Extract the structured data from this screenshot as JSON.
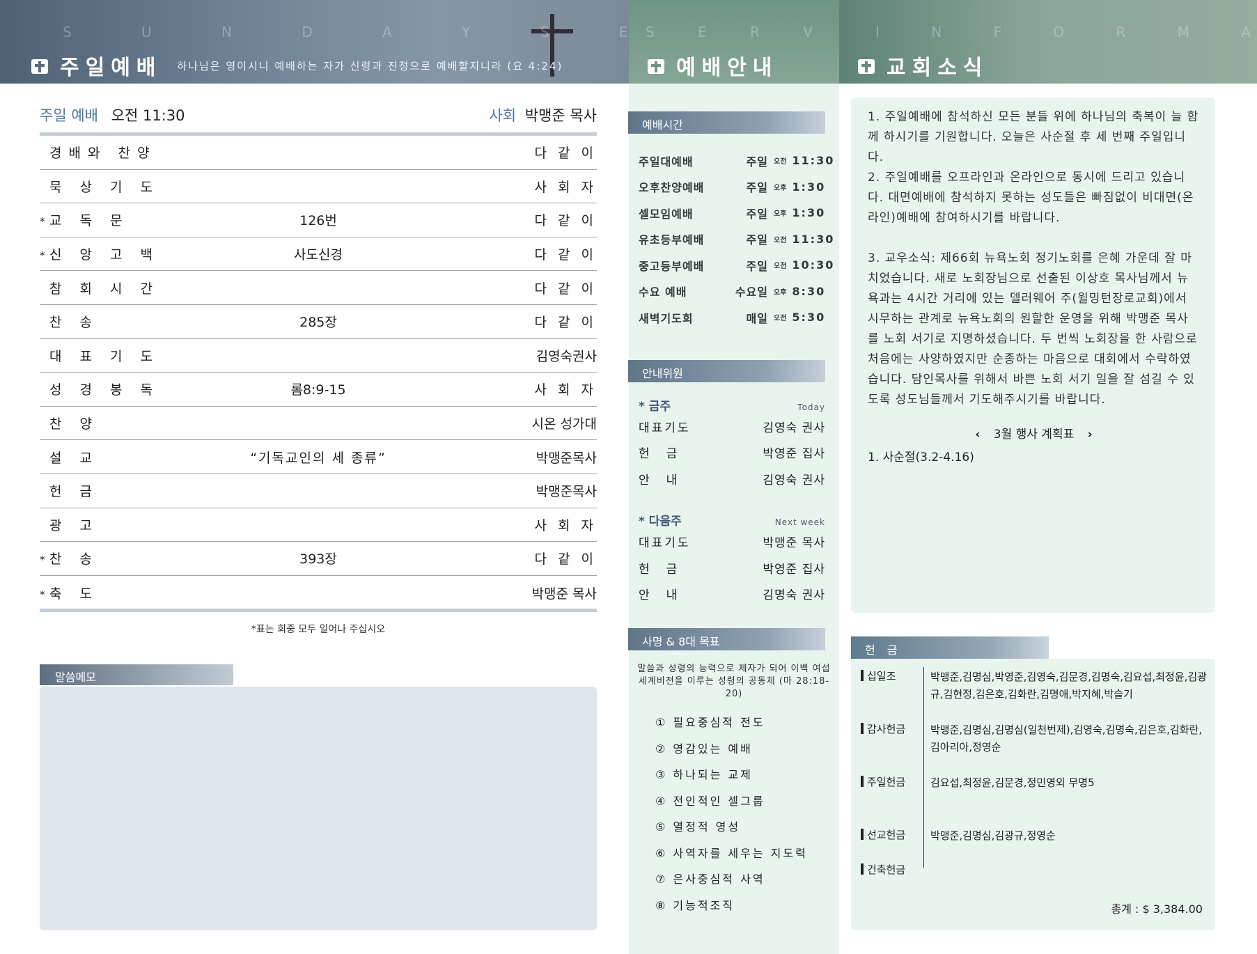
{
  "header_left": {
    "english": "S U N D A Y   S E R V I C E",
    "title": "주일예배",
    "verse": "하나님은 영이시니 예배하는 자가 신령과 진정으로 예배할지니라 (요 4:24)"
  },
  "header_mid": {
    "english": "S E R V I C E",
    "title": "예배안내"
  },
  "header_right": {
    "english": "I N F O R M A T I O N",
    "title": "교회소식"
  },
  "service": {
    "label": "주일 예배",
    "time": "오전 11:30",
    "leader_label": "사회",
    "leader": "박맹준 목사",
    "order": [
      {
        "star": "",
        "item": "경배와 찬양",
        "content": "",
        "person": "다 같 이"
      },
      {
        "star": "",
        "item": "묵 상 기 도",
        "content": "",
        "person": "사 회 자"
      },
      {
        "star": "*",
        "item": "교  독  문",
        "content": "126번",
        "person": "다 같 이"
      },
      {
        "star": "*",
        "item": "신 앙 고 백",
        "content": "사도신경",
        "person": "다 같 이"
      },
      {
        "star": "",
        "item": "참 회 시 간",
        "content": "",
        "person": "다 같 이"
      },
      {
        "star": "",
        "item": "찬     송",
        "content": "285장",
        "person": "다 같 이"
      },
      {
        "star": "",
        "item": "대 표 기 도",
        "content": "",
        "person": "김영숙권사"
      },
      {
        "star": "",
        "item": "성 경 봉 독",
        "content": "롬8:9-15",
        "person": "사 회 자"
      },
      {
        "star": "",
        "item": "찬     양",
        "content": "",
        "person": "시온 성가대"
      },
      {
        "star": "",
        "item": "설     교",
        "content": "“기독교인의 세 종류”",
        "person": "박맹준목사"
      },
      {
        "star": "",
        "item": "헌     금",
        "content": "",
        "person": "박맹준목사"
      },
      {
        "star": "",
        "item": "광     고",
        "content": "",
        "person": "사 회 자"
      },
      {
        "star": "*",
        "item": "찬     송",
        "content": "393장",
        "person": "다 같 이"
      },
      {
        "star": "*",
        "item": "축     도",
        "content": "",
        "person": "박맹준 목사"
      }
    ],
    "footnote": "*표는 회중 모두 일어나 주십시오"
  },
  "memo": {
    "label": "말씀메모"
  },
  "worship_times": {
    "label": "예배시간",
    "rows": [
      {
        "name": "주일대예배",
        "day": "주일",
        "ampm": "오전",
        "time": "11:30"
      },
      {
        "name": "오후찬양예배",
        "day": "주일",
        "ampm": "오후",
        "time": "1:30"
      },
      {
        "name": "셀모임예배",
        "day": "주일",
        "ampm": "오후",
        "time": "1:30"
      },
      {
        "name": "유초등부예배",
        "day": "주일",
        "ampm": "오전",
        "time": "11:30"
      },
      {
        "name": "중고등부예배",
        "day": "주일",
        "ampm": "오전",
        "time": "10:30"
      },
      {
        "name": "수요 예배",
        "day": "수요일",
        "ampm": "오후",
        "time": "8:30"
      },
      {
        "name": "새벽기도회",
        "day": "매일",
        "ampm": "오전",
        "time": "5:30"
      }
    ]
  },
  "guides": {
    "label": "안내위원",
    "this_week": {
      "title": "* 금주",
      "english": "Today",
      "rows": [
        {
          "role": "대표기도",
          "name": "김영숙 권사"
        },
        {
          "role": "헌금",
          "name": "박영준 집사"
        },
        {
          "role": "안내",
          "name": "김영숙 권사"
        }
      ]
    },
    "next_week": {
      "title": "* 다음주",
      "english": "Next week",
      "rows": [
        {
          "role": "대표기도",
          "name": "박맹준 목사"
        },
        {
          "role": "헌금",
          "name": "박영준 집사"
        },
        {
          "role": "안내",
          "name": "김명숙 권사"
        }
      ]
    }
  },
  "mission": {
    "label": "사명 & 8대 목표",
    "statement": "말씀과 성령의 능력으로 제자가 되어 이백 여섭 세계비전을 이루는 성령의 공동체 (마 28:18-20)",
    "goals": [
      "① 필요중심적 전도",
      "② 영감있는 예배",
      "③ 하나되는 교제",
      "④ 전인적인 셀그룹",
      "⑤ 열정적 영성",
      "⑥ 사역자를 세우는 지도력",
      "⑦ 은사중심적 사역",
      "⑧ 기능적조직"
    ]
  },
  "news": {
    "p1": "1. 주일예배에 참석하신 모든 분들 위에 하나님의 축복이 늘 함께 하시기를 기원합니다. 오늘은 사순절 후 세 번째 주일입니다.",
    "p2": "2. 주일예배를 오프라인과 온라인으로 동시에 드리고 있습니다. 대면예배에 참석하지 못하는 성도들은 빠짐없이 비대면(온라인)예배에 참여하시기를 바랍니다.",
    "p3": "3. 교우소식: 제66회 뉴욕노회 정기노회를 은혜 가운데 잘 마치었습니다. 새로 노회장님으로 선출된 이상호 목사님께서 뉴욕과는 4시간 거리에 있는 델러웨어 주(윌밍턴장로교회)에서 시무하는 관계로 뉴욕노회의 원할한 운영을 위해 박맹준 목사를 노회 서기로 지명하셨습니다. 두 번씩 노회장을 한 사람으로 처음에는 사양하였지만 순종하는 마음으로 대회에서 수락하였습니다. 담인목사를 위해서 바쁜 노회 서기 일을 잘 섬길 수 있도록 성도님들께서 기도해주시기를 바랍니다.",
    "plan_title": "3월 행사 계획표",
    "plan_items": [
      "1. 사순절(3.2-4.16)"
    ]
  },
  "offering": {
    "label": "헌 금",
    "rows": [
      {
        "key": "십일조",
        "names": "박맹준,김명심,박영준,김영숙,김문경,김명숙,김요섭,최정윤,김광규,김현정,김은호,김화란,김명애,박지혜,박슬기"
      },
      {
        "key": "감사헌금",
        "names": "박맹준,김명심,김명심(일천번제),김영숙,김명숙,김은호,김화란,김아리아,정영순"
      },
      {
        "key": "주일헌금",
        "names": "김요섭,최정윤,김문경,정민영외 무명5"
      },
      {
        "key": "선교헌금",
        "names": "박맹준,김명심,김광규,정영순"
      },
      {
        "key": "건축헌금",
        "names": ""
      }
    ],
    "total": "총계 : $ 3,384.00"
  }
}
